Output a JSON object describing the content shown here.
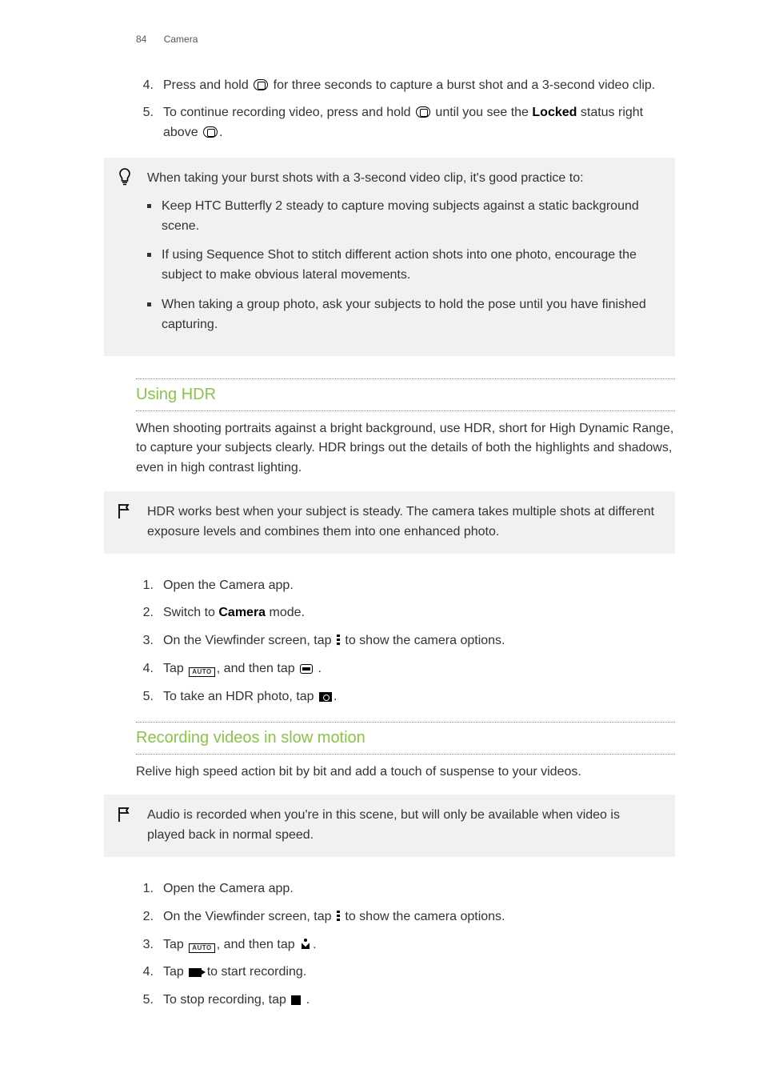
{
  "header": {
    "page_number": "84",
    "section": "Camera"
  },
  "top_steps": [
    {
      "n": "4.",
      "before": "Press and hold ",
      "after": " for three seconds to capture a burst shot and a 3-second video clip.",
      "icon": "camera"
    },
    {
      "n": "5.",
      "t1": "To continue recording video, press and hold ",
      "t2": " until you see the ",
      "bold": "Locked",
      "t3": " status right above ",
      "t4": ".",
      "iconA": "camera",
      "iconB": "camera"
    }
  ],
  "tip1": {
    "lead": "When taking your burst shots with a 3-second video clip, it's good practice to:",
    "bullets": [
      "Keep HTC Butterfly 2 steady to capture moving subjects against a static background scene.",
      "If using Sequence Shot to stitch different action shots into one photo, encourage the subject to make obvious lateral movements.",
      "When taking a group photo, ask your subjects to hold the pose until you have finished capturing."
    ]
  },
  "hdr": {
    "heading": "Using HDR",
    "intro": "When shooting portraits against a bright background, use HDR, short for High Dynamic Range, to capture your subjects clearly. HDR brings out the details of both the highlights and shadows, even in high contrast lighting.",
    "note": "HDR works best when your subject is steady. The camera takes multiple shots at different exposure levels and combines them into one enhanced photo.",
    "steps": {
      "s1": {
        "n": "1.",
        "text": "Open the Camera app."
      },
      "s2": {
        "n": "2.",
        "a": "Switch to ",
        "bold": "Camera",
        "b": " mode."
      },
      "s3": {
        "n": "3.",
        "a": "On the Viewfinder screen, tap ",
        "b": " to show the camera options."
      },
      "s4": {
        "n": "4.",
        "a": "Tap ",
        "b": ", and then tap ",
        "c": " ."
      },
      "s5": {
        "n": "5.",
        "a": "To take an HDR photo, tap ",
        "b": "."
      }
    }
  },
  "slow": {
    "heading": "Recording videos in slow motion",
    "intro": "Relive high speed action bit by bit and add a touch of suspense to your videos.",
    "note": "Audio is recorded when you're in this scene, but will only be available when video is played back in normal speed.",
    "steps": {
      "s1": {
        "n": "1.",
        "text": "Open the Camera app."
      },
      "s2": {
        "n": "2.",
        "a": "On the Viewfinder screen, tap ",
        "b": " to show the camera options."
      },
      "s3": {
        "n": "3.",
        "a": "Tap ",
        "b": ", and then tap ",
        "c": "."
      },
      "s4": {
        "n": "4.",
        "a": "Tap ",
        "b": " to start recording."
      },
      "s5": {
        "n": "5.",
        "a": "To stop recording, tap ",
        "b": " ."
      }
    }
  }
}
